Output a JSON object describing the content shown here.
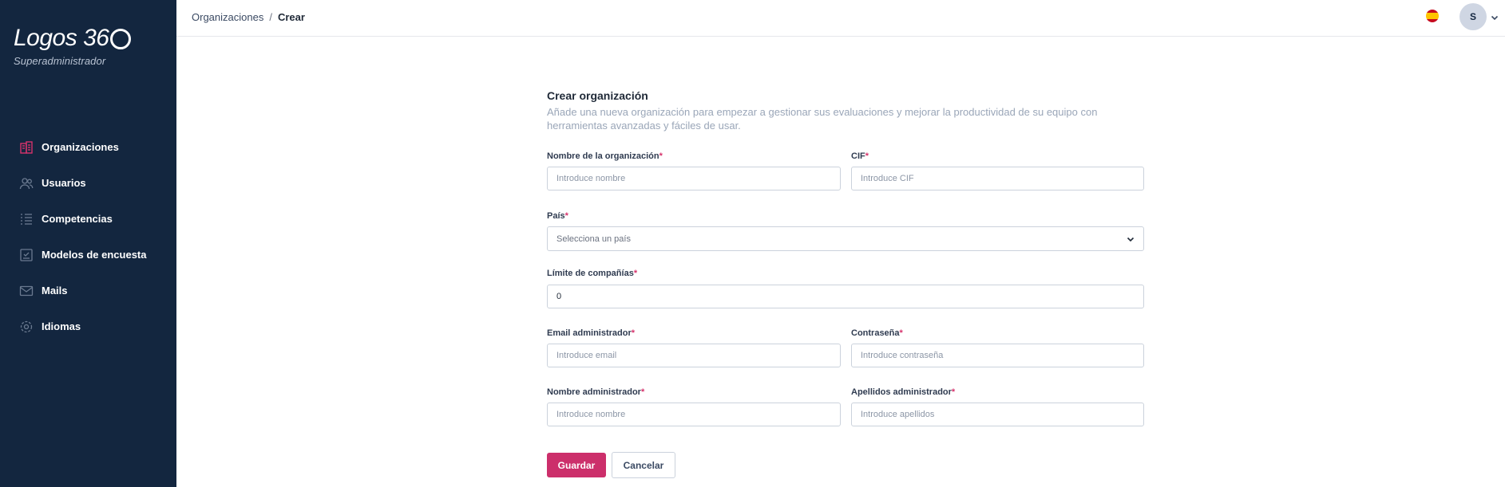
{
  "app": {
    "brand": "Logos 36",
    "role": "Superadministrador"
  },
  "sidebar": {
    "items": [
      {
        "label": "Organizaciones",
        "icon": "building-icon",
        "active": true
      },
      {
        "label": "Usuarios",
        "icon": "users-icon"
      },
      {
        "label": "Competencias",
        "icon": "list-icon"
      },
      {
        "label": "Modelos de encuesta",
        "icon": "survey-icon"
      },
      {
        "label": "Mails",
        "icon": "mail-icon"
      },
      {
        "label": "Idiomas",
        "icon": "gear-icon"
      }
    ]
  },
  "header": {
    "breadcrumb": {
      "parent": "Organizaciones",
      "separator": "/",
      "current": "Crear"
    },
    "language_flag": "spain-flag-icon",
    "avatar_initial": "S"
  },
  "form": {
    "title": "Crear organización",
    "description": "Añade una nueva organización para empezar a gestionar sus evaluaciones y mejorar la productividad de su equipo con herramientas avanzadas y fáciles de usar.",
    "required_mark": "*",
    "org_name": {
      "label": "Nombre de la organización",
      "placeholder": "Introduce nombre",
      "value": ""
    },
    "cif": {
      "label": "CIF",
      "placeholder": "Introduce CIF",
      "value": ""
    },
    "country": {
      "label": "País",
      "selected": "Selecciona un país"
    },
    "company_limit": {
      "label": "Límite de compañías",
      "value": "0"
    },
    "admin_email": {
      "label": "Email administrador",
      "placeholder": "Introduce email",
      "value": ""
    },
    "password": {
      "label": "Contraseña",
      "placeholder": "Introduce contraseña",
      "value": ""
    },
    "admin_name": {
      "label": "Nombre administrador",
      "placeholder": "Introduce nombre",
      "value": ""
    },
    "admin_surname": {
      "label": "Apellidos administrador",
      "placeholder": "Introduce apellidos",
      "value": ""
    },
    "save_label": "Guardar",
    "cancel_label": "Cancelar"
  },
  "colors": {
    "sidebar_bg": "#13263f",
    "accent": "#cc2f6b",
    "active_icon": "#d6336c"
  }
}
